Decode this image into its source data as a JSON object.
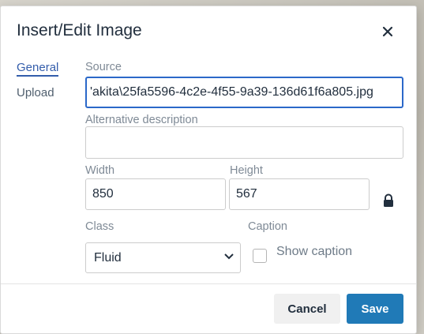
{
  "dialog": {
    "title": "Insert/Edit Image"
  },
  "tabs": [
    {
      "label": "General",
      "active": true
    },
    {
      "label": "Upload",
      "active": false
    }
  ],
  "source": {
    "label": "Source",
    "value": "'akita\\25fa5596-4c2e-4f55-9a39-136d61f6a805.jpg"
  },
  "alt": {
    "label": "Alternative description",
    "value": ""
  },
  "width": {
    "label": "Width",
    "value": "850"
  },
  "height": {
    "label": "Height",
    "value": "567"
  },
  "class_field": {
    "label": "Class",
    "selected": "Fluid"
  },
  "caption": {
    "label": "Caption",
    "checkbox_label": "Show caption",
    "checked": false
  },
  "buttons": {
    "cancel": "Cancel",
    "save": "Save"
  },
  "colors": {
    "accent": "#207ab7",
    "tab_active": "#335dab",
    "focus_border": "#2b68c9"
  },
  "icons": {
    "close": "close-icon",
    "lock": "lock-icon",
    "chevron": "chevron-down-icon"
  }
}
